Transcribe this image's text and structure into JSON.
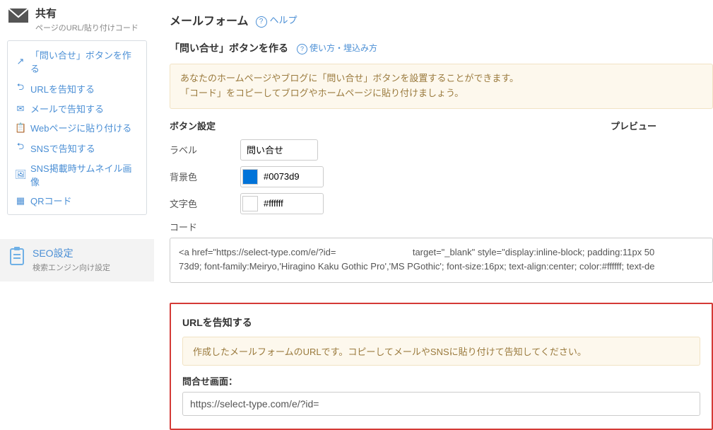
{
  "share": {
    "title": "共有",
    "subtitle": "ページのURL/貼り付けコード"
  },
  "menu": [
    {
      "icon": "external-link-icon",
      "glyph": "↗",
      "label": "「問い合せ」ボタンを作る"
    },
    {
      "icon": "share-icon",
      "glyph": "⮌",
      "label": "URLを告知する"
    },
    {
      "icon": "envelope-icon",
      "glyph": "✉",
      "label": "メールで告知する"
    },
    {
      "icon": "paste-icon",
      "glyph": "📋",
      "label": "Webページに貼り付ける"
    },
    {
      "icon": "sns-share-icon",
      "glyph": "⮌",
      "label": "SNSで告知する"
    },
    {
      "icon": "image-icon",
      "glyph": "🖼",
      "label": "SNS掲載時サムネイル画像"
    },
    {
      "icon": "qr-icon",
      "glyph": "▦",
      "label": "QRコード"
    }
  ],
  "seo": {
    "title": "SEO設定",
    "subtitle": "検索エンジン向け設定"
  },
  "main": {
    "page_title": "メールフォーム",
    "help_label": "ヘルプ",
    "sub_heading": "「問い合せ」ボタンを作る",
    "usage_label": "使い方・埋込み方",
    "info_line1": "あなたのホームページやブログに「問い合せ」ボタンを設置することができます。",
    "info_line2": "「コード」をコピーしてブログやホームページに貼り付けましょう。",
    "col_settings": "ボタン設定",
    "col_preview": "プレビュー",
    "labels": {
      "label": "ラベル",
      "bg": "背景色",
      "fg": "文字色",
      "code": "コード"
    },
    "values": {
      "label": "問い合せ",
      "bg": "#0073d9",
      "fg": "#ffffff"
    },
    "colors": {
      "bg_swatch": "#0073d9",
      "fg_swatch": "#ffffff"
    },
    "code_text": "<a href=\"https://select-type.com/e/?id=                              target=\"_blank\" style=\"display:inline-block; padding:11px 50\n73d9; font-family:Meiryo,'Hiragino Kaku Gothic Pro','MS PGothic'; font-size:16px; text-align:center; color:#ffffff; text-de"
  },
  "url_section": {
    "heading": "URLを告知する",
    "info": "作成したメールフォームのURLです。コピーしてメールやSNSに貼り付けて告知してください。",
    "field_label": "問合せ画面：",
    "url_value": "https://select-type.com/e/?id="
  }
}
